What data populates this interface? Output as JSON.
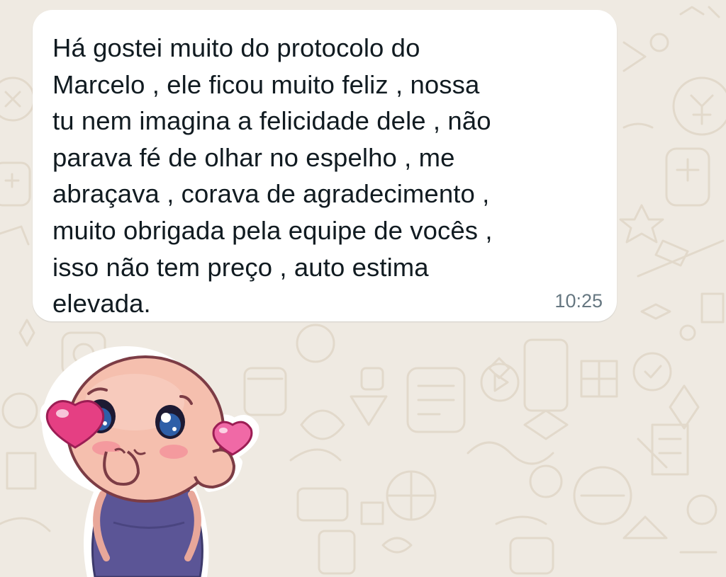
{
  "message": {
    "text": "Há gostei muito do protocolo do\nMarcelo , ele ficou muito feliz , nossa\ntu nem imagina a felicidade dele , não\nparava fé de olhar no espelho , me\nabraçava , corava de agradecimento ,\nmuito obrigada pela equipe de vocês ,\nisso não tem preço , auto estima\nelevada.",
    "time": "10:25"
  },
  "sticker": {
    "icon": "love-heart-eyes-sticker"
  },
  "colors": {
    "wallpaper": "#efeae2",
    "doodle": "#e0d6c7",
    "bubble": "#ffffff",
    "text": "#111b21",
    "time": "#667781"
  }
}
